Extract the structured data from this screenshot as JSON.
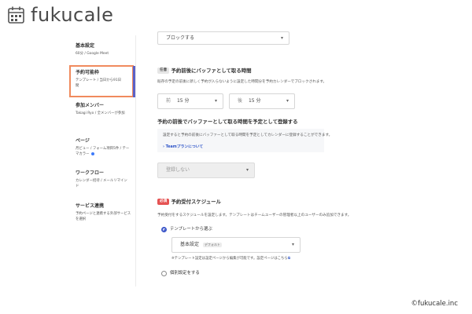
{
  "brand": {
    "name": "fukucale"
  },
  "sidebar": {
    "items": [
      {
        "title": "基本設定",
        "sub": "60分 / Google Meet"
      },
      {
        "title": "予約可能枠",
        "sub": "テンプレート / 当日から91日間"
      },
      {
        "title": "参加メンバー",
        "sub": "Takagi Ryo / 全メンバーが参加"
      },
      {
        "title": "ページ",
        "sub": "月ビュー / フォーム項目5件 / テーマカラー"
      },
      {
        "title": "ワークフロー",
        "sub": "カレンダー招待 / メールリマインド"
      },
      {
        "title": "サービス連携",
        "sub": "予約ページと連携する外部サービスを選択"
      }
    ]
  },
  "main": {
    "top_select": {
      "value": "ブロックする"
    },
    "buffer": {
      "tag": "任意",
      "title": "予約前後にバッファとして取る時間",
      "desc": "既存の予定の前後に新しく予約が入らないように設定した時間分を予約カレンダーでブロックされます。",
      "before_label": "前",
      "before_value": "15 分",
      "after_label": "後",
      "after_value": "15 分"
    },
    "buffer_register": {
      "title": "予約の前後でバッファーとして取る時間を予定として登録する",
      "desc": "設定すると予約の前後にバッファーとして取る時間を予定としてカレンダーに登録することができます。",
      "link": "› Teamプランについて",
      "select_value": "登録しない"
    },
    "schedule": {
      "tag": "必須",
      "title": "予約受付スケジュール",
      "desc": "予約受付をするスケジュールを設定します。テンプレートはチームユーザーの管理者以上のユーザーのみ追加できます。",
      "radio_template": "テンプレートから選ぶ",
      "template_select": "基本設定",
      "default_badge": "デフォルト",
      "note": "※テンプレート設定は設定ページから編集が可能です。設定ページはこちら",
      "radio_custom": "個別設定をする"
    }
  },
  "footer": {
    "copyright": "©fukucale.inc"
  },
  "colors": {
    "accent": "#3e58c9",
    "highlight": "#f08a5d",
    "required": "#e55353",
    "selected_bar": "#5b62c8"
  }
}
